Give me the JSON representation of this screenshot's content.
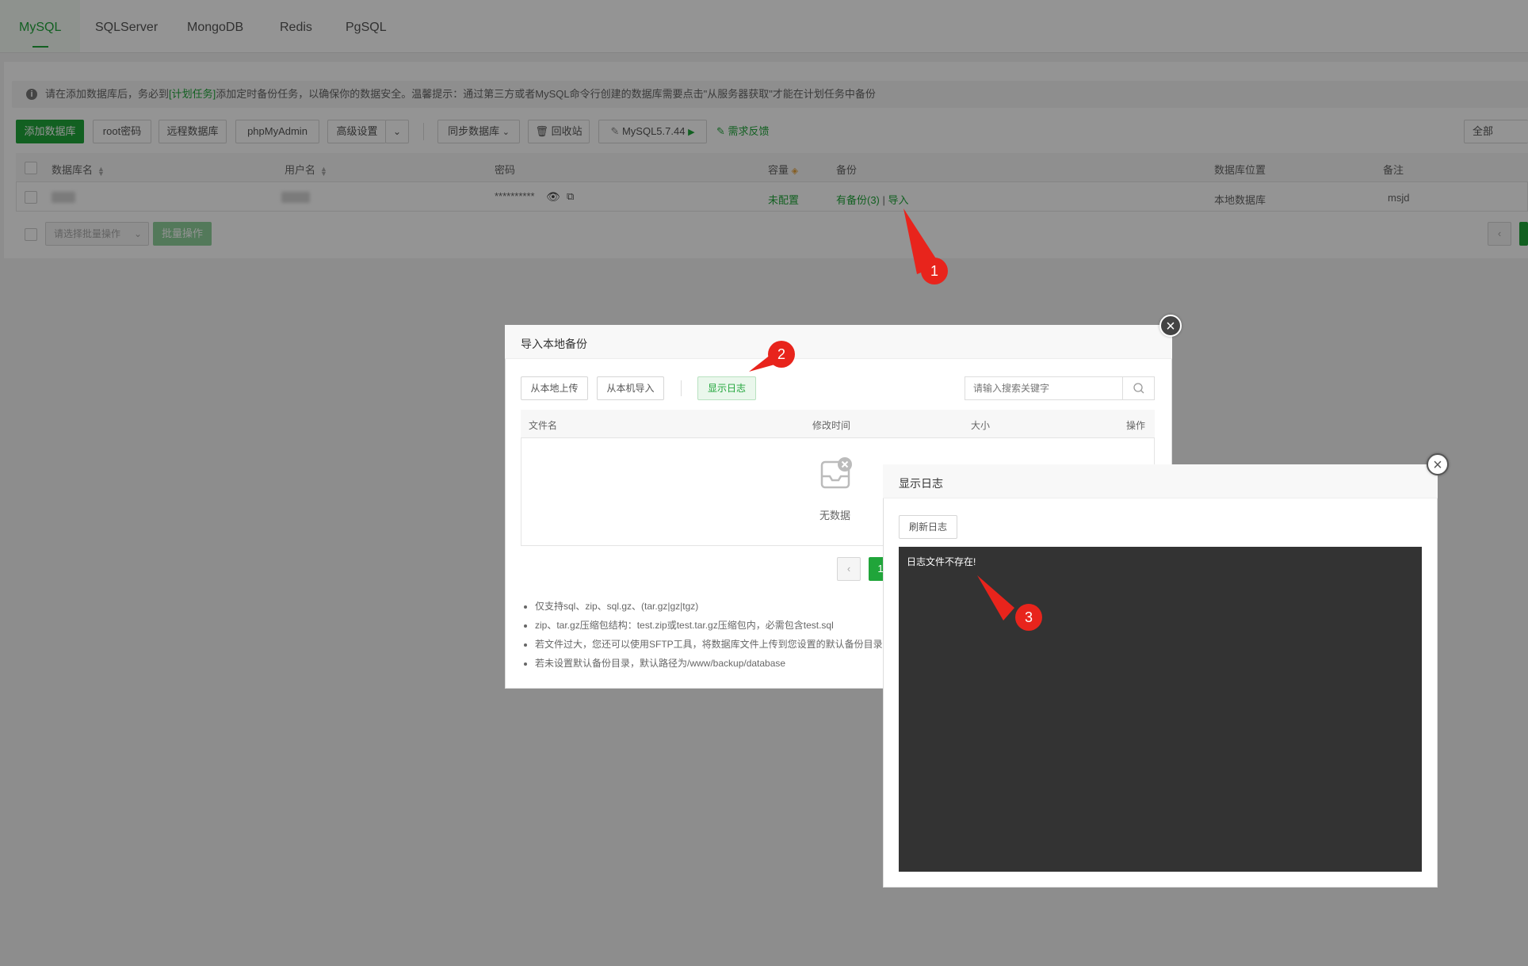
{
  "tabs": [
    "MySQL",
    "SQLServer",
    "MongoDB",
    "Redis",
    "PgSQL"
  ],
  "notice": {
    "prefix": "请在添加数据库后，务必到",
    "link": "[计划任务]",
    "suffix": "添加定时备份任务，以确保你的数据安全。温馨提示：通过第三方或者MySQL命令行创建的数据库需要点击\"从服务器获取\"才能在计划任务中备份"
  },
  "toolbar": {
    "add_db": "添加数据库",
    "root_pwd": "root密码",
    "remote_db": "远程数据库",
    "phpmyadmin": "phpMyAdmin",
    "advanced": "高级设置",
    "sync_db": "同步数据库",
    "recycle": "回收站",
    "mysql_version": "MySQL5.7.44",
    "feedback": "需求反馈",
    "filter_all": "全部"
  },
  "table": {
    "headers": {
      "name": "数据库名",
      "user": "用户名",
      "password": "密码",
      "capacity": "容量",
      "backup": "备份",
      "location": "数据库位置",
      "note": "备注"
    },
    "row": {
      "password_mask": "**********",
      "capacity": "未配置",
      "backup_has": "有备份(3)",
      "backup_sep": "|",
      "backup_import": "导入",
      "location": "本地数据库",
      "note": "msjd"
    }
  },
  "batch": {
    "select_placeholder": "请选择批量操作",
    "button": "批量操作"
  },
  "import_modal": {
    "title": "导入本地备份",
    "upload_btn": "从本地上传",
    "import_btn": "从本机导入",
    "show_log_btn": "显示日志",
    "search_placeholder": "请输入搜索关键字",
    "columns": {
      "filename": "文件名",
      "mtime": "修改时间",
      "size": "大小",
      "action": "操作"
    },
    "empty_text": "无数据",
    "page_number": "1",
    "notes": [
      "仅支持sql、zip、sql.gz、(tar.gz|gz|tgz)",
      "zip、tar.gz压缩包结构：test.zip或test.tar.gz压缩包内，必需包含test.sql",
      "若文件过大，您还可以使用SFTP工具，将数据库文件上传到您设置的默认备份目录",
      "若未设置默认备份目录，默认路径为/www/backup/database"
    ]
  },
  "log_modal": {
    "title": "显示日志",
    "refresh_btn": "刷新日志",
    "log_text": "日志文件不存在!"
  },
  "markers": [
    "1",
    "2",
    "3"
  ]
}
